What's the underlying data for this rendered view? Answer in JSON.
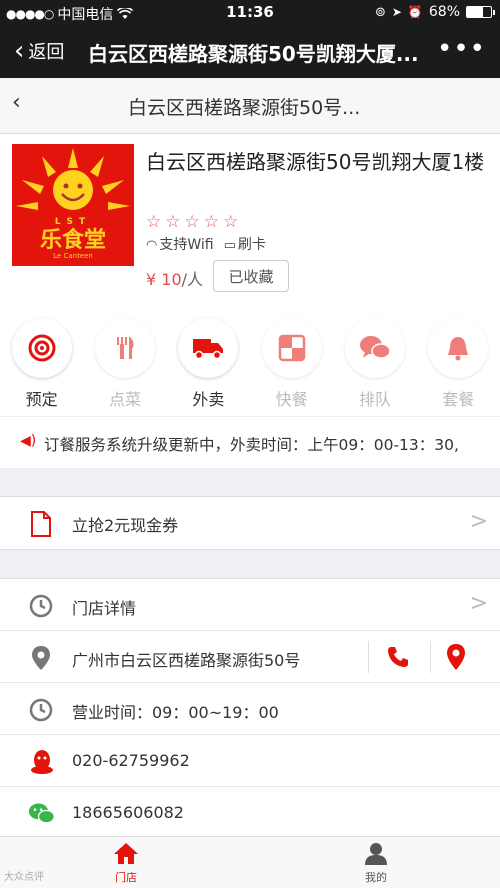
{
  "status_bar": {
    "carrier": "中国电信",
    "time": "11:36",
    "battery": "68%",
    "battery_level": 0.68
  },
  "wechat_nav": {
    "back_label": "返回",
    "title": "白云区西槎路聚源街50号凯翔大厦..."
  },
  "page_header": {
    "title": "白云区西槎路聚源街50号..."
  },
  "store": {
    "logo_text_top": "LST",
    "logo_text_main": "乐食堂",
    "logo_text_sub": "Le Canteen",
    "name": "白云区西槎路聚源街50号凯翔大厦1楼",
    "rating_stars": "☆☆☆☆☆",
    "rating": 0,
    "features": [
      "支持Wifi",
      "刷卡"
    ],
    "price_prefix": "¥ 10",
    "price_unit": "/人",
    "favorite_label": "已收藏"
  },
  "services": [
    {
      "label": "预定",
      "icon": "target-icon",
      "enabled": true
    },
    {
      "label": "点菜",
      "icon": "utensils-icon",
      "enabled": false
    },
    {
      "label": "外卖",
      "icon": "truck-icon",
      "enabled": true
    },
    {
      "label": "快餐",
      "icon": "fastfood-icon",
      "enabled": false
    },
    {
      "label": "排队",
      "icon": "chat-icon",
      "enabled": false
    },
    {
      "label": "套餐",
      "icon": "bell-icon",
      "enabled": false
    }
  ],
  "notice": {
    "text": "订餐服务系统升级更新中，外卖时间：上午09：00-13：30,"
  },
  "coupon": {
    "label": "立抢2元现金券",
    "arrow": ">"
  },
  "info": {
    "detail_label": "门店详情",
    "detail_arrow": ">",
    "address": "广州市白云区西槎路聚源街50号",
    "hours": "营业时间：09：00~19：00",
    "qq": "020-62759962",
    "wechat": "18665606082"
  },
  "tabbar": {
    "store_label": "门店",
    "mine_label": "我的"
  },
  "watermark": "大众点评",
  "colors": {
    "accent": "#e3140c",
    "nav_bg": "#1b1b1b",
    "wechat_green": "#3ab54a"
  }
}
